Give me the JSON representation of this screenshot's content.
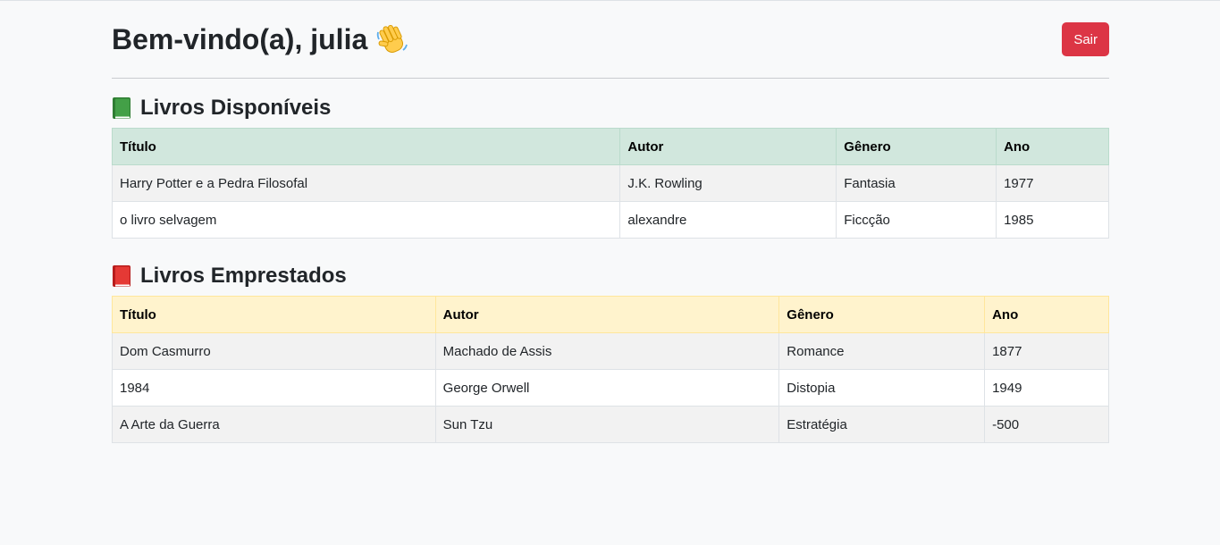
{
  "header": {
    "welcome": "Bem-vindo(a), julia",
    "logout_label": "Sair"
  },
  "available": {
    "title": "Livros Disponíveis",
    "columns": [
      "Título",
      "Autor",
      "Gênero",
      "Ano"
    ],
    "rows": [
      [
        "Harry Potter e a Pedra Filosofal",
        "J.K. Rowling",
        "Fantasia",
        "1977"
      ],
      [
        "o livro selvagem",
        "alexandre",
        "Ficcção",
        "1985"
      ]
    ]
  },
  "borrowed": {
    "title": "Livros Emprestados",
    "columns": [
      "Título",
      "Autor",
      "Gênero",
      "Ano"
    ],
    "rows": [
      [
        "Dom Casmurro",
        "Machado de Assis",
        "Romance",
        "1877"
      ],
      [
        "1984",
        "George Orwell",
        "Distopia",
        "1949"
      ],
      [
        "A Arte da Guerra",
        "Sun Tzu",
        "Estratégia",
        "-500"
      ]
    ]
  },
  "colors": {
    "logout": "#dc3545",
    "available_header": "#d1e7dd",
    "borrowed_header": "#fff3cd"
  },
  "icons": {
    "welcome": "waving-hand-icon",
    "available": "green-book-icon",
    "borrowed": "red-book-icon"
  }
}
